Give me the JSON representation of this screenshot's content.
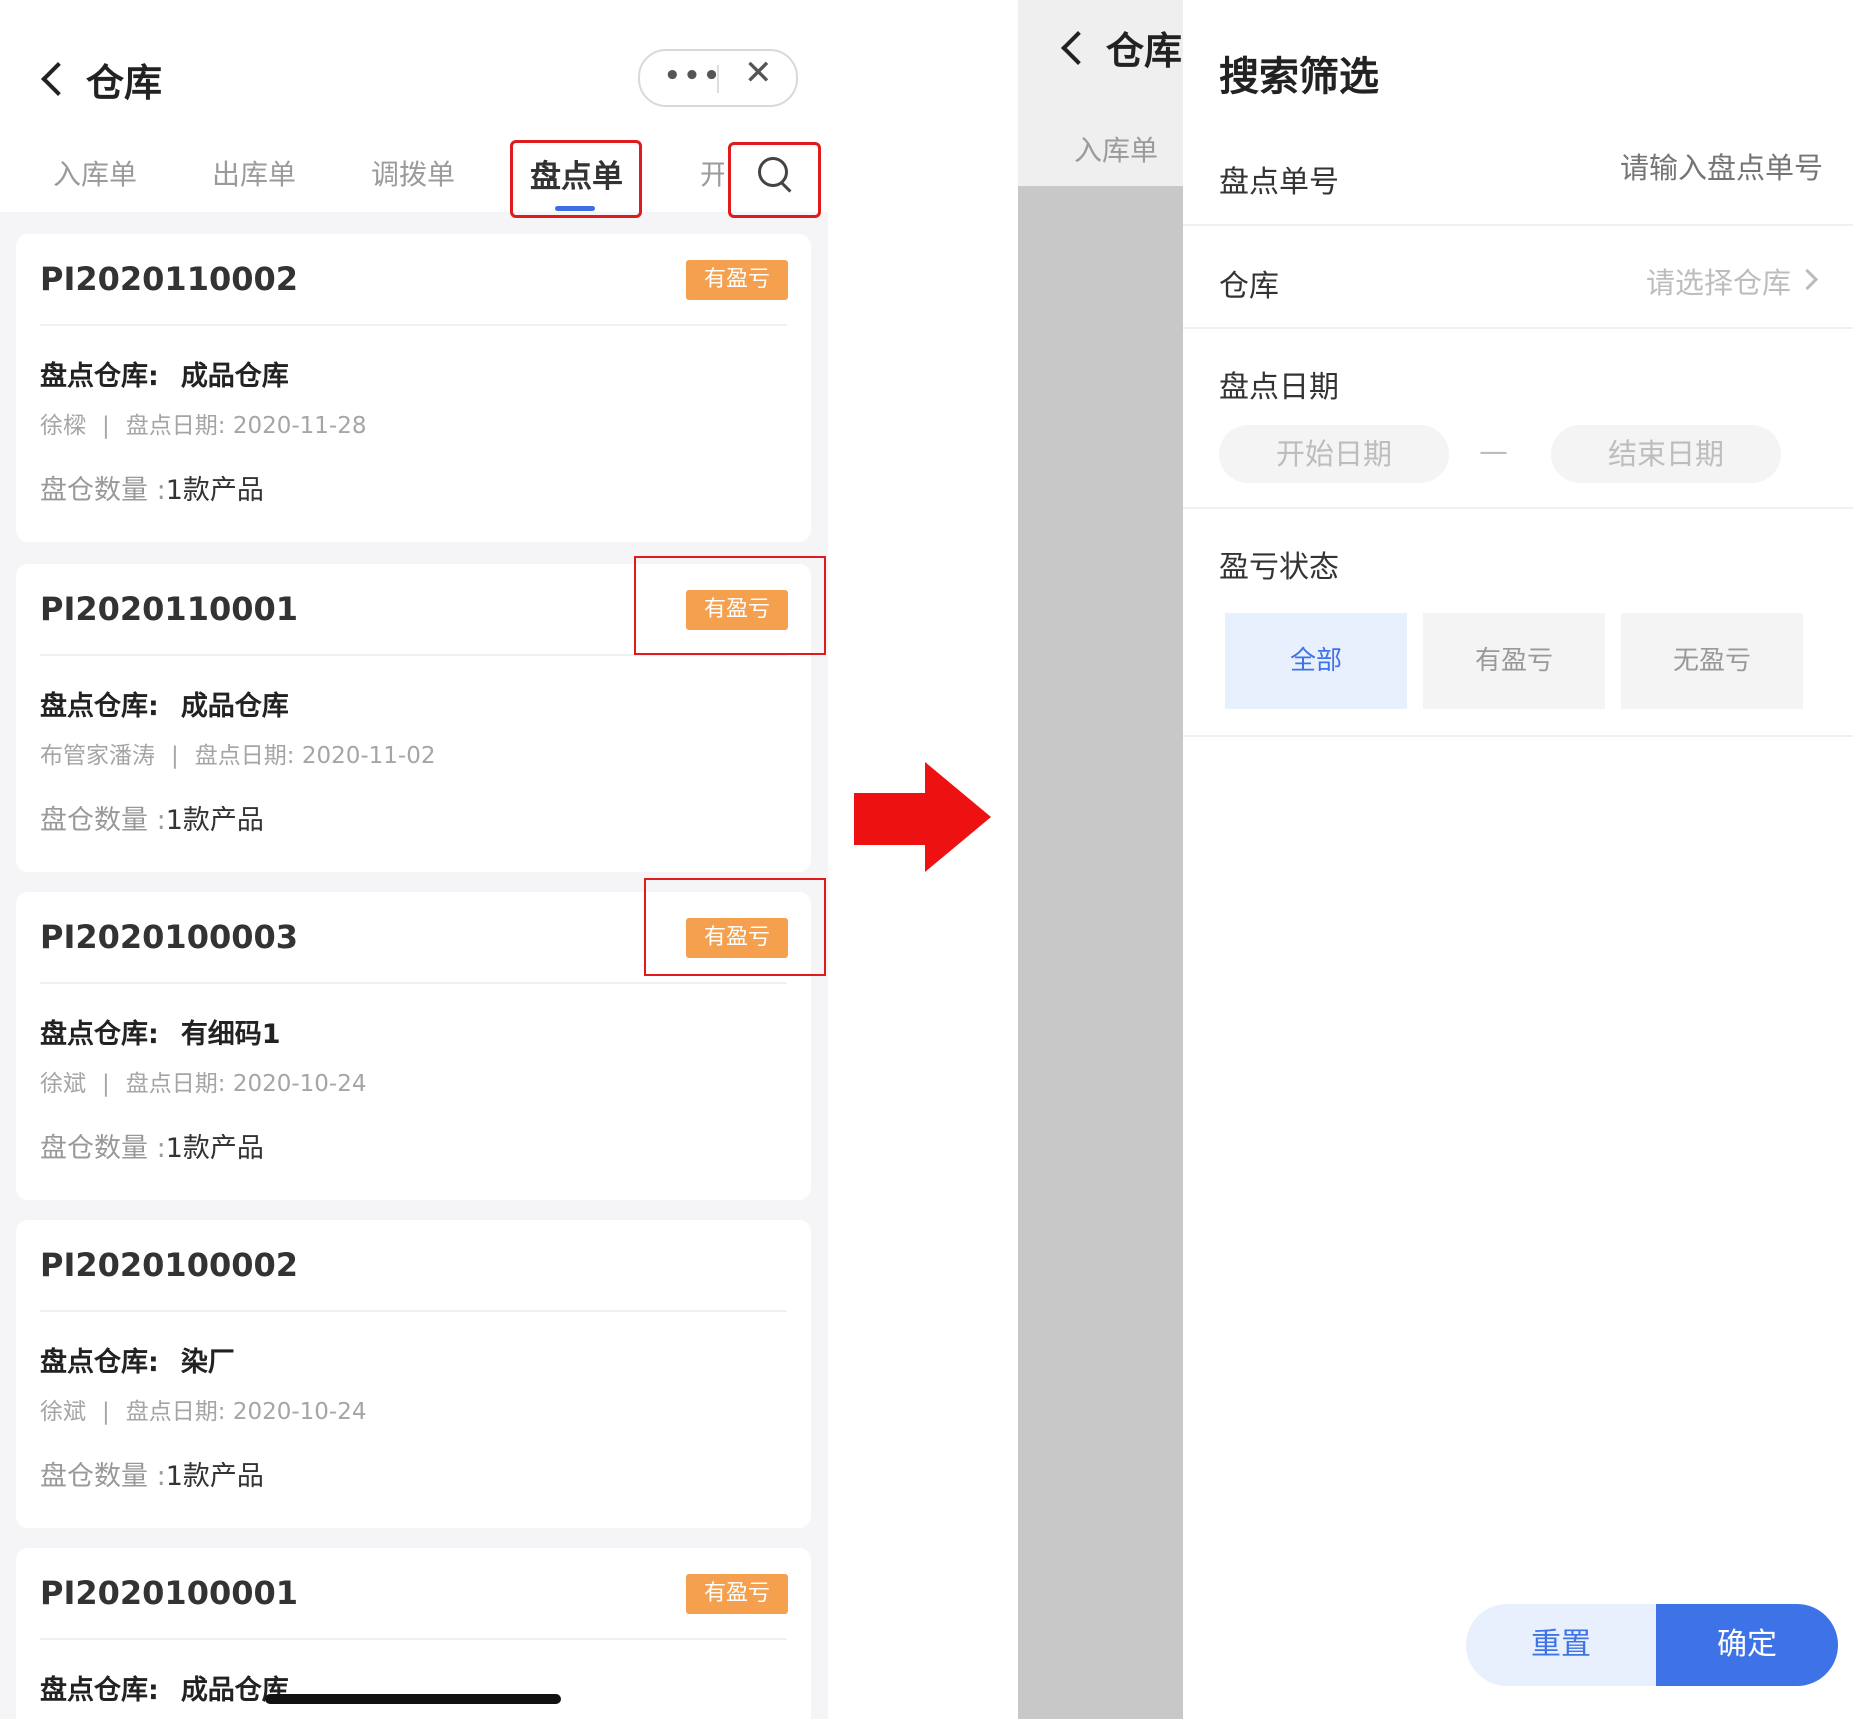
{
  "left": {
    "nav_title": "仓库",
    "capsule": {
      "more": "•••",
      "close": "✕"
    },
    "tabs": [
      "入库单",
      "出库单",
      "调拨单",
      "盘点单",
      "开"
    ],
    "active_tab_index": 3,
    "cards": [
      {
        "code": "PI2020110002",
        "badge": "有盈亏",
        "warehouse_label": "盘点仓库:",
        "warehouse": "成品仓库",
        "operator": "徐樑",
        "sep": "|",
        "date_label": "盘点日期:",
        "date": "2020-11-28",
        "qty_label": "盘仓数量 :",
        "qty": "1款产品"
      },
      {
        "code": "PI2020110001",
        "badge": "有盈亏",
        "warehouse_label": "盘点仓库:",
        "warehouse": "成品仓库",
        "operator": "布管家潘涛",
        "sep": "|",
        "date_label": "盘点日期:",
        "date": "2020-11-02",
        "qty_label": "盘仓数量 :",
        "qty": "1款产品"
      },
      {
        "code": "PI2020100003",
        "badge": "有盈亏",
        "warehouse_label": "盘点仓库:",
        "warehouse": "有细码1",
        "operator": "徐斌",
        "sep": "|",
        "date_label": "盘点日期:",
        "date": "2020-10-24",
        "qty_label": "盘仓数量 :",
        "qty": "1款产品"
      },
      {
        "code": "PI2020100002",
        "badge": "",
        "warehouse_label": "盘点仓库:",
        "warehouse": "染厂",
        "operator": "徐斌",
        "sep": "|",
        "date_label": "盘点日期:",
        "date": "2020-10-24",
        "qty_label": "盘仓数量 :",
        "qty": "1款产品"
      },
      {
        "code": "PI2020100001",
        "badge": "有盈亏",
        "warehouse_label": "盘点仓库:",
        "warehouse": "成品仓库"
      }
    ]
  },
  "right": {
    "bg_nav_title": "仓库",
    "bg_tab": "入库单",
    "panel_title": "搜索筛选",
    "order_no_label": "盘点单号",
    "order_no_placeholder": "请输入盘点单号",
    "warehouse_label": "仓库",
    "warehouse_placeholder": "请选择仓库",
    "date_label": "盘点日期",
    "start_date": "开始日期",
    "date_dash": "—",
    "end_date": "结束日期",
    "status_label": "盈亏状态",
    "status_options": [
      "全部",
      "有盈亏",
      "无盈亏"
    ],
    "selected_status_index": 0,
    "reset_label": "重置",
    "confirm_label": "确定"
  },
  "colors": {
    "accent": "#3e73e8",
    "badge": "#f5a04e",
    "highlight": "#e01b1b",
    "arrow": "#ee1111"
  }
}
